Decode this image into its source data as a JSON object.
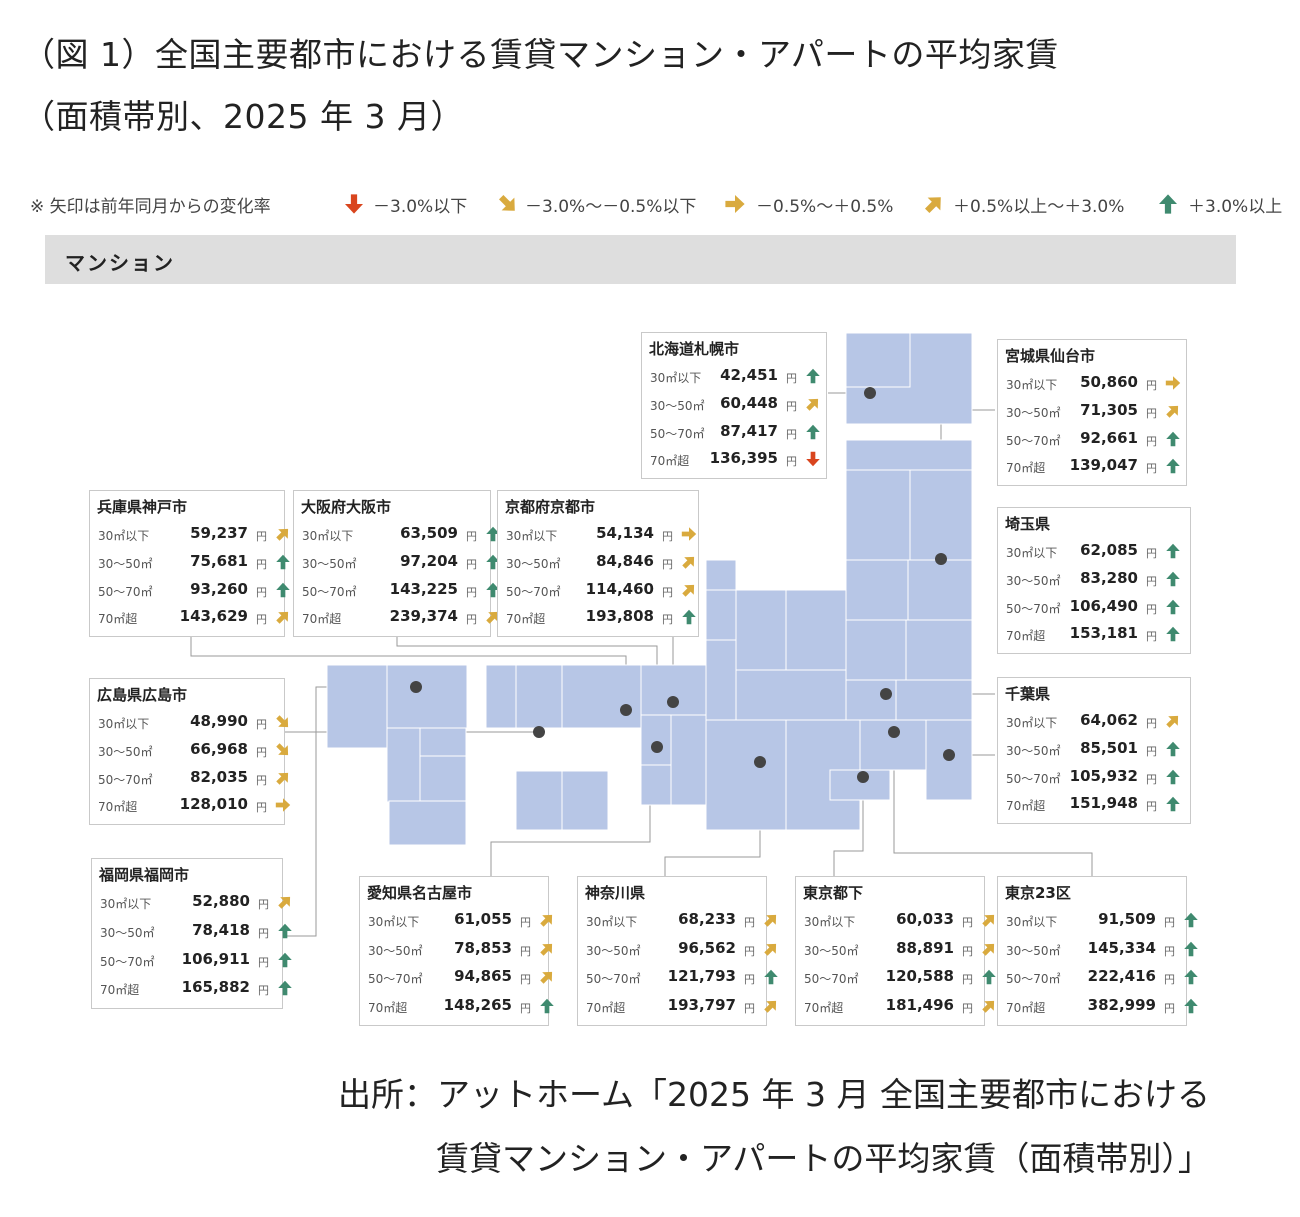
{
  "title_line1": "（図 1）全国主要都市における賃貸マンション・アパートの平均家賃",
  "title_line2": "（面積帯別、2025 年 3 月）",
  "legend": {
    "note": "※ 矢印は前年同月からの変化率",
    "items": [
      {
        "label": "－3.0%以下",
        "icon": "arrow-down-icon",
        "color": "#d9451e"
      },
      {
        "label": "－3.0%～－0.5%以下",
        "icon": "arrow-down-right-icon",
        "color": "#d9aa3e"
      },
      {
        "label": "－0.5%～＋0.5%",
        "icon": "arrow-right-icon",
        "color": "#d9aa3e"
      },
      {
        "label": "＋0.5%以上～＋3.0%",
        "icon": "arrow-up-right-icon",
        "color": "#d9aa3e"
      },
      {
        "label": "＋3.0%以上",
        "icon": "arrow-up-icon",
        "color": "#3f8a6f"
      }
    ]
  },
  "section_label": "マンション",
  "yen_unit": "円",
  "row_labels": [
    "30㎡以下",
    "30～50㎡",
    "50～70㎡",
    "70㎡超"
  ],
  "map": {
    "fill_color": "#b7c6e6",
    "line_color": "#9a9a9a",
    "marker_color": "#444444"
  },
  "cities": [
    {
      "name": "北海道札幌市",
      "values": [
        "42,451",
        "60,448",
        "87,417",
        "136,395"
      ],
      "trend": [
        "up",
        "up-right",
        "up",
        "down"
      ]
    },
    {
      "name": "宮城県仙台市",
      "values": [
        "50,860",
        "71,305",
        "92,661",
        "139,047"
      ],
      "trend": [
        "right",
        "up-right",
        "up",
        "up"
      ]
    },
    {
      "name": "兵庫県神戸市",
      "values": [
        "59,237",
        "75,681",
        "93,260",
        "143,629"
      ],
      "trend": [
        "up-right",
        "up",
        "up",
        "up-right"
      ]
    },
    {
      "name": "大阪府大阪市",
      "values": [
        "63,509",
        "97,204",
        "143,225",
        "239,374"
      ],
      "trend": [
        "up",
        "up",
        "up",
        "up-right"
      ]
    },
    {
      "name": "京都府京都市",
      "values": [
        "54,134",
        "84,846",
        "114,460",
        "193,808"
      ],
      "trend": [
        "right",
        "up-right",
        "up-right",
        "up"
      ]
    },
    {
      "name": "埼玉県",
      "values": [
        "62,085",
        "83,280",
        "106,490",
        "153,181"
      ],
      "trend": [
        "up",
        "up",
        "up",
        "up"
      ]
    },
    {
      "name": "広島県広島市",
      "values": [
        "48,990",
        "66,968",
        "82,035",
        "128,010"
      ],
      "trend": [
        "down-right",
        "down-right",
        "up-right",
        "right"
      ]
    },
    {
      "name": "千葉県",
      "values": [
        "64,062",
        "85,501",
        "105,932",
        "151,948"
      ],
      "trend": [
        "up-right",
        "up",
        "up",
        "up"
      ]
    },
    {
      "name": "福岡県福岡市",
      "values": [
        "52,880",
        "78,418",
        "106,911",
        "165,882"
      ],
      "trend": [
        "up-right",
        "up",
        "up",
        "up"
      ]
    },
    {
      "name": "愛知県名古屋市",
      "values": [
        "61,055",
        "78,853",
        "94,865",
        "148,265"
      ],
      "trend": [
        "up-right",
        "up-right",
        "up-right",
        "up"
      ]
    },
    {
      "name": "神奈川県",
      "values": [
        "68,233",
        "96,562",
        "121,793",
        "193,797"
      ],
      "trend": [
        "up-right",
        "up-right",
        "up",
        "up-right"
      ]
    },
    {
      "name": "東京都下",
      "values": [
        "60,033",
        "88,891",
        "120,588",
        "181,496"
      ],
      "trend": [
        "up-right",
        "up-right",
        "up",
        "up-right"
      ]
    },
    {
      "name": "東京23区",
      "values": [
        "91,509",
        "145,334",
        "222,416",
        "382,999"
      ],
      "trend": [
        "up",
        "up",
        "up",
        "up"
      ]
    }
  ],
  "source_line1": "出所：アットホーム「2025 年 3 月 全国主要都市における",
  "source_line2": "賃貸マンション・アパートの平均家賃（面積帯別）」"
}
